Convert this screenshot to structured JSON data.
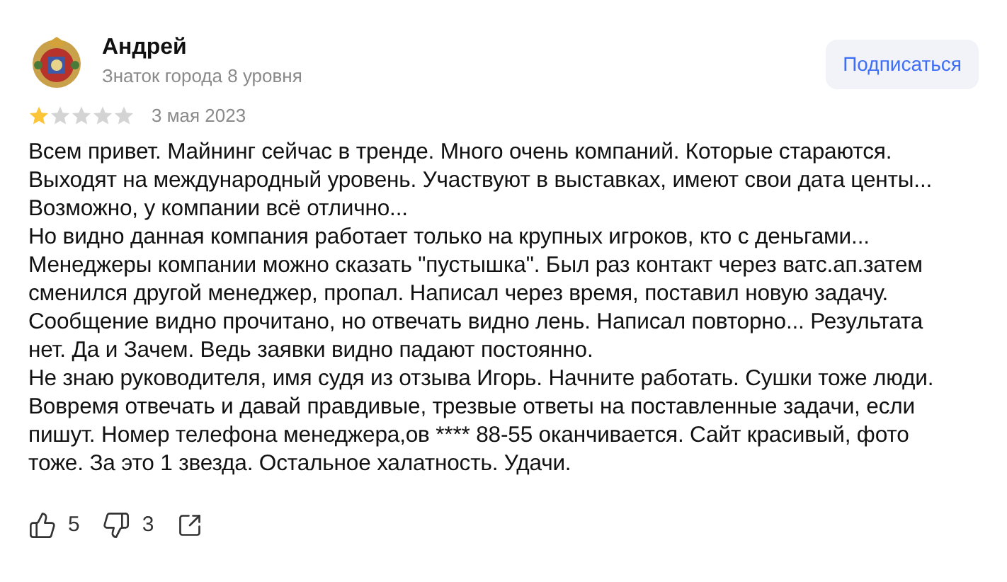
{
  "author": {
    "name": "Андрей",
    "level": "Знаток города 8 уровня"
  },
  "subscribe_button": "Подписаться",
  "rating": {
    "stars": 1
  },
  "date": "3 мая 2023",
  "paragraphs": [
    "Всем привет. Майнинг сейчас в тренде. Много очень компаний. Которые стараются. Выходят на международный уровень. Участвуют в выставках, имеют свои дата центы...",
    "Возможно, у компании всё отлично...",
    "Но видно данная компания работает только на крупных игроков, кто с деньгами...",
    "Менеджеры компании можно сказать \"пустышка\". Был раз контакт через ватс.ап.затем сменился другой менеджер, пропал. Написал через время, поставил новую задачу. Сообщение видно прочитано, но отвечать видно лень. Написал повторно... Результата нет. Да и Зачем. Ведь заявки видно падают постоянно.",
    "Не знаю руководителя, имя судя из отзыва Игорь. Начните работать. Сушки тоже люди. Вовремя отвечать и давай правдивые, трезвые ответы на поставленные задачи, если пишут. Номер телефона менеджера,ов **** 88-55 оканчивается. Сайт красивый, фото тоже. За это 1 звезда. Остальное халатность. Удачи."
  ],
  "reactions": {
    "likes": "5",
    "dislikes": "3"
  }
}
